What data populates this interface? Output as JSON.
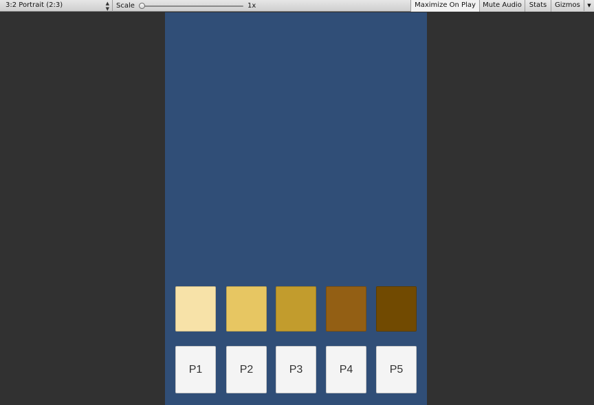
{
  "toolbar": {
    "aspect_label": "3:2 Portrait (2:3)",
    "scale_label": "Scale",
    "scale_value": "1x",
    "maximize_label": "Maximize On Play",
    "mute_label": "Mute Audio",
    "stats_label": "Stats",
    "gizmos_label": "Gizmos"
  },
  "game": {
    "background_color": "#304e77",
    "swatches": [
      {
        "color": "#f7e2a8"
      },
      {
        "color": "#e7c662"
      },
      {
        "color": "#c29c2d"
      },
      {
        "color": "#935f14"
      },
      {
        "color": "#714a01"
      }
    ],
    "buttons": [
      {
        "label": "P1"
      },
      {
        "label": "P2"
      },
      {
        "label": "P3"
      },
      {
        "label": "P4"
      },
      {
        "label": "P5"
      }
    ]
  }
}
